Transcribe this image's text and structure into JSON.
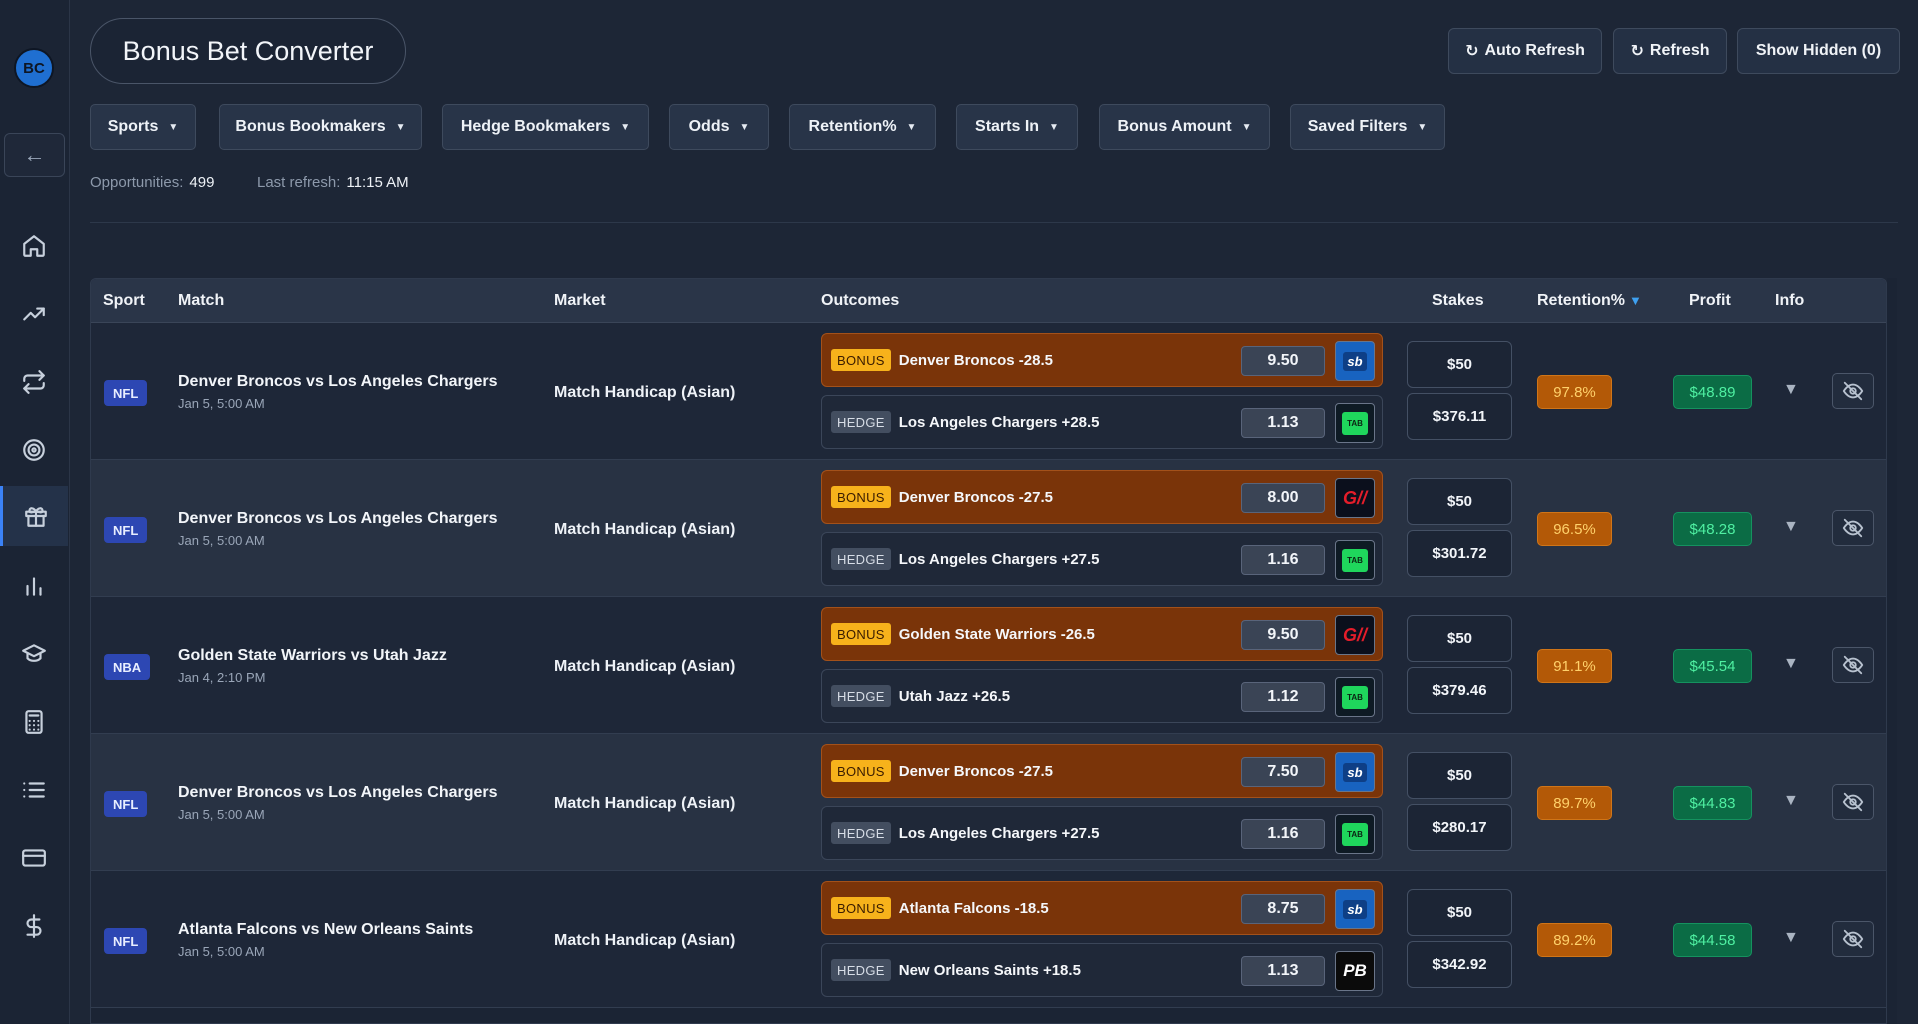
{
  "app": {
    "title": "Bonus Bet Converter",
    "logo_text": "BC",
    "back_glyph": "←"
  },
  "sidebar": {
    "items": [
      {
        "icon": "home-icon"
      },
      {
        "icon": "trending-up-icon"
      },
      {
        "icon": "repeat-icon"
      },
      {
        "icon": "target-icon"
      },
      {
        "icon": "gift-icon",
        "active": true
      },
      {
        "icon": "bar-chart-icon"
      },
      {
        "icon": "graduation-cap-icon"
      },
      {
        "icon": "calculator-icon"
      },
      {
        "icon": "list-icon"
      },
      {
        "icon": "credit-card-icon"
      },
      {
        "icon": "dollar-icon"
      }
    ]
  },
  "header": {
    "auto_refresh": "Auto Refresh",
    "refresh": "Refresh",
    "show_hidden": "Show Hidden (0)",
    "refresh_glyph": "↻"
  },
  "filters": [
    "Sports",
    "Bonus Bookmakers",
    "Hedge Bookmakers",
    "Odds",
    "Retention%",
    "Starts In",
    "Bonus Amount",
    "Saved Filters"
  ],
  "meta": {
    "opportunities_label": "Opportunities:",
    "opportunities_value": "499",
    "last_refresh_label": "Last refresh:",
    "last_refresh_value": "11:15 AM"
  },
  "table": {
    "columns": {
      "sport": "Sport",
      "match": "Match",
      "market": "Market",
      "outcomes": "Outcomes",
      "stakes": "Stakes",
      "retention": "Retention%",
      "profit": "Profit",
      "info": "Info"
    },
    "sort_indicator": "▼",
    "bonus_tag": "BONUS",
    "hedge_tag": "HEDGE",
    "expand_glyph": "▼",
    "rows": [
      {
        "sport": "NFL",
        "match": "Denver Broncos vs Los Angeles Chargers",
        "date": "Jan 5, 5:00 AM",
        "market": "Match Handicap (Asian)",
        "bonus": {
          "label": "Denver Broncos -28.5",
          "odds": "9.50",
          "book": "sb",
          "book_text": "sb"
        },
        "hedge": {
          "label": "Los Angeles Chargers +28.5",
          "odds": "1.13",
          "book": "tab",
          "book_text": "TAB"
        },
        "stake_bonus": "$50",
        "stake_hedge": "$376.11",
        "retention": "97.8%",
        "profit": "$48.89"
      },
      {
        "sport": "NFL",
        "match": "Denver Broncos vs Los Angeles Chargers",
        "date": "Jan 5, 5:00 AM",
        "market": "Match Handicap (Asian)",
        "bonus": {
          "label": "Denver Broncos -27.5",
          "odds": "8.00",
          "book": "gw",
          "book_text": "G//"
        },
        "hedge": {
          "label": "Los Angeles Chargers +27.5",
          "odds": "1.16",
          "book": "tab",
          "book_text": "TAB"
        },
        "stake_bonus": "$50",
        "stake_hedge": "$301.72",
        "retention": "96.5%",
        "profit": "$48.28"
      },
      {
        "sport": "NBA",
        "match": "Golden State Warriors vs Utah Jazz",
        "date": "Jan 4, 2:10 PM",
        "market": "Match Handicap (Asian)",
        "bonus": {
          "label": "Golden State Warriors -26.5",
          "odds": "9.50",
          "book": "gw",
          "book_text": "G//"
        },
        "hedge": {
          "label": "Utah Jazz +26.5",
          "odds": "1.12",
          "book": "tab",
          "book_text": "TAB"
        },
        "stake_bonus": "$50",
        "stake_hedge": "$379.46",
        "retention": "91.1%",
        "profit": "$45.54"
      },
      {
        "sport": "NFL",
        "match": "Denver Broncos vs Los Angeles Chargers",
        "date": "Jan 5, 5:00 AM",
        "market": "Match Handicap (Asian)",
        "bonus": {
          "label": "Denver Broncos -27.5",
          "odds": "7.50",
          "book": "sb",
          "book_text": "sb"
        },
        "hedge": {
          "label": "Los Angeles Chargers +27.5",
          "odds": "1.16",
          "book": "tab",
          "book_text": "TAB"
        },
        "stake_bonus": "$50",
        "stake_hedge": "$280.17",
        "retention": "89.7%",
        "profit": "$44.83"
      },
      {
        "sport": "NFL",
        "match": "Atlanta Falcons vs New Orleans Saints",
        "date": "Jan 5, 5:00 AM",
        "market": "Match Handicap (Asian)",
        "bonus": {
          "label": "Atlanta Falcons -18.5",
          "odds": "8.75",
          "book": "sb",
          "book_text": "sb"
        },
        "hedge": {
          "label": "New Orleans Saints +18.5",
          "odds": "1.13",
          "book": "pb",
          "book_text": "PB"
        },
        "stake_bonus": "$50",
        "stake_hedge": "$342.92",
        "retention": "89.2%",
        "profit": "$44.58"
      }
    ]
  }
}
